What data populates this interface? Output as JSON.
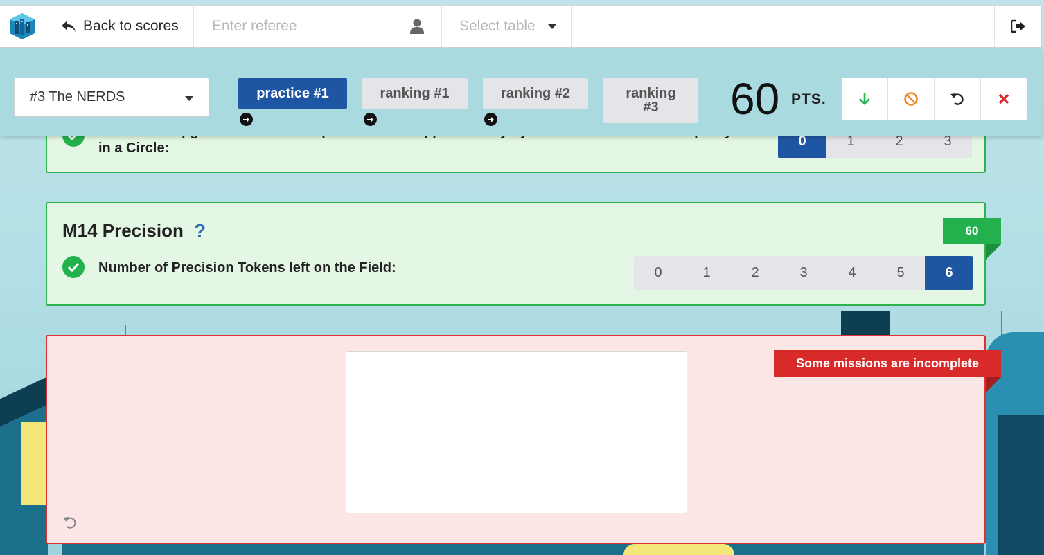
{
  "nav": {
    "back_label": "Back to scores",
    "referee_placeholder": "Enter referee",
    "table_placeholder": "Select table"
  },
  "scorebar": {
    "team": "#3 The NERDS",
    "stages": [
      {
        "label": "practice #1",
        "active": true
      },
      {
        "label": "ranking #1",
        "active": false
      },
      {
        "label": "ranking #2",
        "active": false
      },
      {
        "label": "ranking #3",
        "active": false
      }
    ],
    "score": "60",
    "score_unit": "PTS."
  },
  "missions": {
    "prev": {
      "question": "Number of Upgrades that are independent and supported only by a Stack which is at least partly in a Circle:",
      "options": [
        "0",
        "1",
        "2",
        "3"
      ],
      "selected": "0"
    },
    "m14": {
      "title": "M14 Precision",
      "help": "?",
      "points": "60",
      "question": "Number of Precision Tokens left on the Field:",
      "options": [
        "0",
        "1",
        "2",
        "3",
        "4",
        "5",
        "6"
      ],
      "selected": "6"
    }
  },
  "signature": {
    "warning": "Some missions are incomplete"
  },
  "colors": {
    "primary": "#1f56a3",
    "success": "#22b14c",
    "danger": "#d92a2a",
    "warning": "#ef8a2c"
  }
}
